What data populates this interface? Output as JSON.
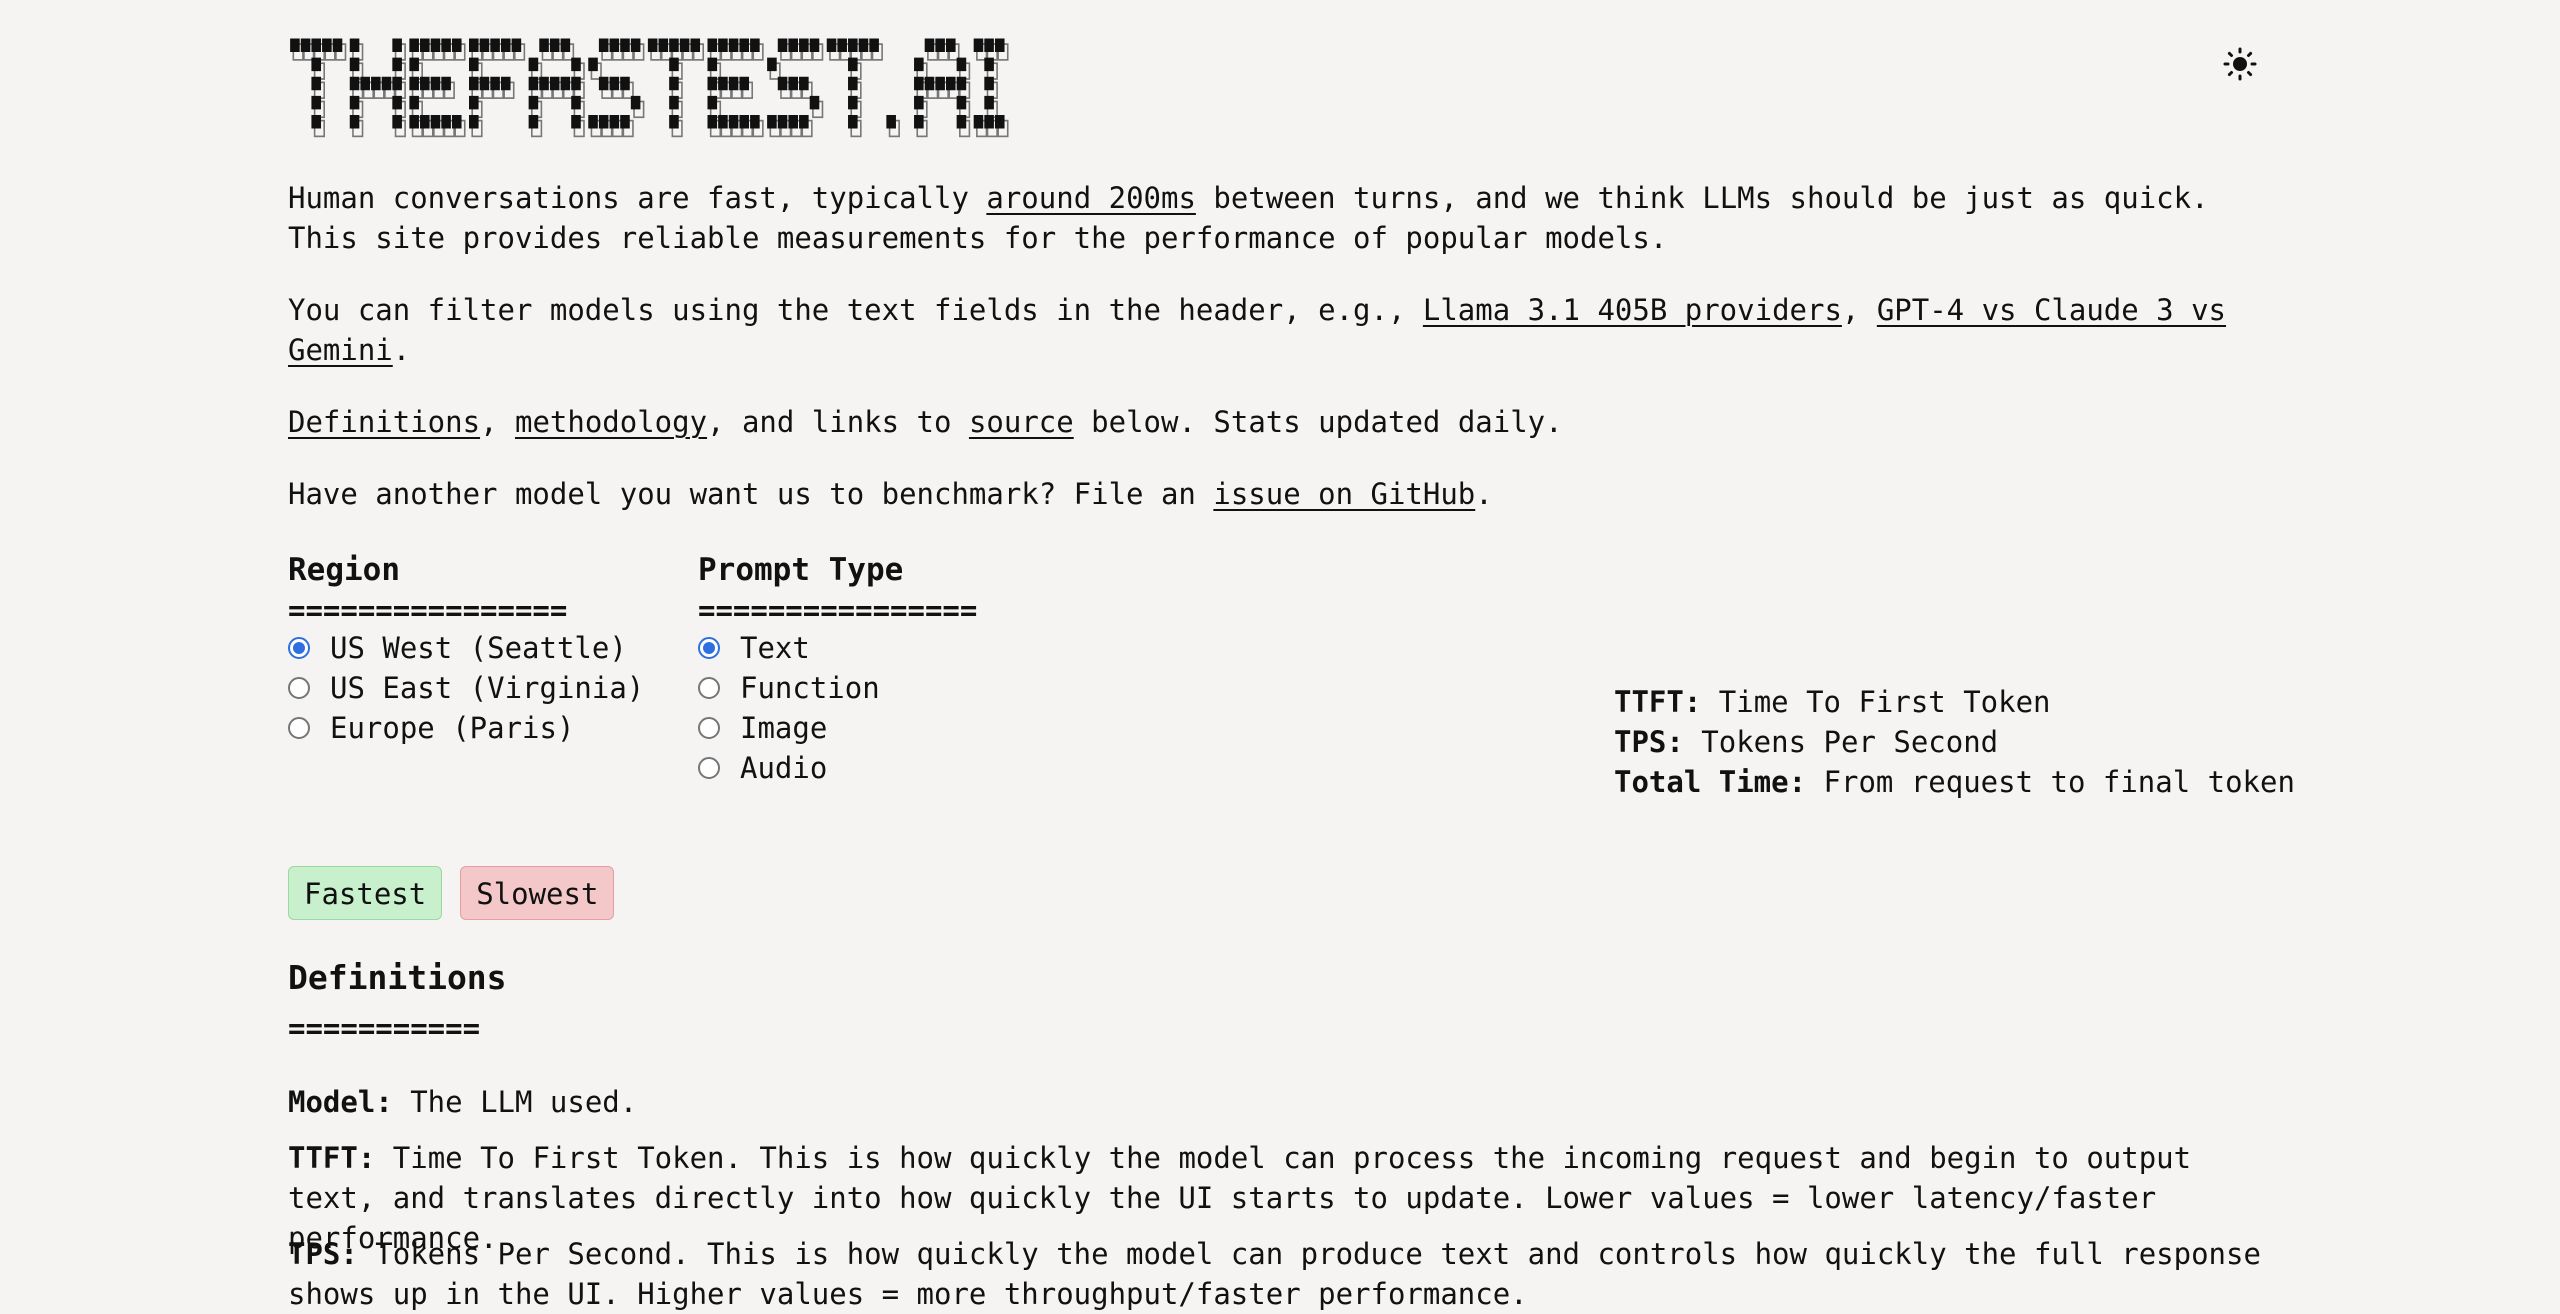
{
  "site": {
    "logo_text": "THEFASTEST.AI"
  },
  "intro": {
    "p1_before": "Human conversations are fast, typically ",
    "p1_link": "around 200ms",
    "p1_after": " between turns, and we think LLMs should be just as quick. This site provides reliable measurements for the performance of popular models.",
    "p2_before": "You can filter models using the text fields in the header, e.g., ",
    "p2_link1": "Llama 3.1 405B providers",
    "p2_sep": ", ",
    "p2_link2": "GPT-4 vs Claude 3 vs Gemini",
    "p2_after": ".",
    "p3_link1": "Definitions",
    "p3_sep1": ", ",
    "p3_link2": "methodology",
    "p3_mid": ", and links to ",
    "p3_link3": "source",
    "p3_after": " below. Stats updated daily.",
    "p4_before": "Have another model you want us to benchmark? File an ",
    "p4_link": "issue on GitHub",
    "p4_after": "."
  },
  "region": {
    "title": "Region",
    "underline": "================",
    "options": [
      "US West (Seattle)",
      "US East (Virginia)",
      "Europe (Paris)"
    ],
    "selected": "US West (Seattle)"
  },
  "prompt_type": {
    "title": "Prompt Type",
    "underline": "================",
    "options": [
      "Text",
      "Function",
      "Image",
      "Audio"
    ],
    "selected": "Text"
  },
  "legend": {
    "ttft_label": "TTFT:",
    "ttft_text": " Time To First Token",
    "tps_label": "TPS:",
    "tps_text": " Tokens Per Second",
    "total_label": "Total Time:",
    "total_text": " From request to final token"
  },
  "badges": {
    "fastest": "Fastest",
    "slowest": "Slowest",
    "fastest_color": "#c8f0cc",
    "slowest_color": "#f4c8c8"
  },
  "definitions": {
    "title": "Definitions",
    "underline": "===========",
    "model_label": "Model:",
    "model_text": " The LLM used.",
    "ttft_label": "TTFT:",
    "ttft_text": " Time To First Token. This is how quickly the model can process the incoming request and begin to output text, and translates directly into how quickly the UI starts to update. Lower values = lower latency/faster performance.",
    "tps_label": "TPS:",
    "tps_text": " Tokens Per Second. This is how quickly the model can produce text and controls how quickly the full response shows up in the UI. Higher values = more throughput/faster performance."
  },
  "icons": {
    "theme_toggle": "sun-icon"
  }
}
